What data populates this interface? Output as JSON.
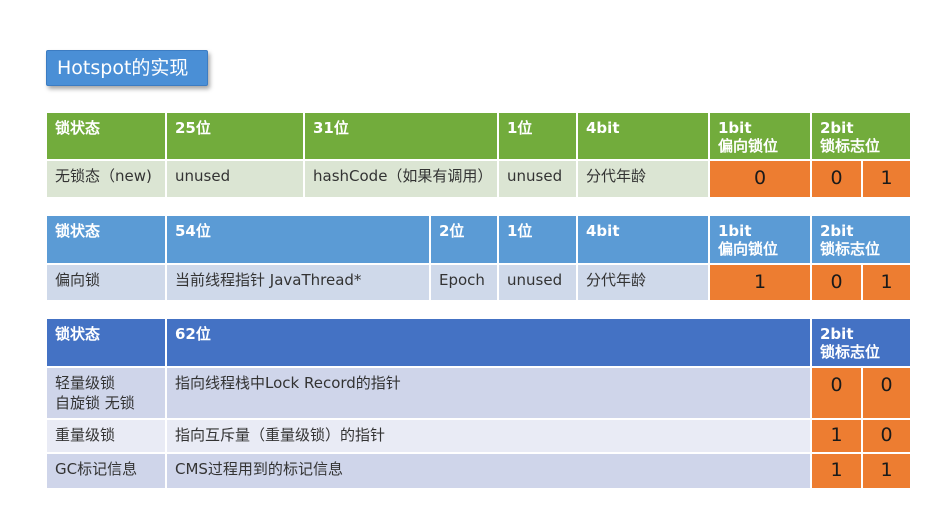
{
  "title": "Hotspot的实现",
  "table1": {
    "headers": [
      "锁状态",
      "25位",
      "31位",
      "1位",
      "4bit",
      "1bit\n偏向锁位",
      "2bit\n锁标志位"
    ],
    "row": [
      "无锁态（new)",
      "unused",
      "hashCode（如果有调用）",
      "unused",
      "分代年龄",
      "0",
      "0",
      "1"
    ]
  },
  "table2": {
    "headers": [
      "锁状态",
      "54位",
      "2位",
      "1位",
      "4bit",
      "1bit\n偏向锁位",
      "2bit\n锁标志位"
    ],
    "row": [
      "偏向锁",
      "当前线程指针 JavaThread*",
      "Epoch",
      "unused",
      "分代年龄",
      "1",
      "0",
      "1"
    ]
  },
  "table3": {
    "headers": [
      "锁状态",
      "62位",
      "2bit\n锁标志位"
    ],
    "rows": [
      [
        "轻量级锁\n自旋锁 无锁",
        "指向线程栈中Lock Record的指针",
        "0",
        "0"
      ],
      [
        "重量级锁",
        "指向互斥量（重量级锁）的指针",
        "1",
        "0"
      ],
      [
        "GC标记信息",
        "CMS过程用到的标记信息",
        "1",
        "1"
      ]
    ]
  }
}
